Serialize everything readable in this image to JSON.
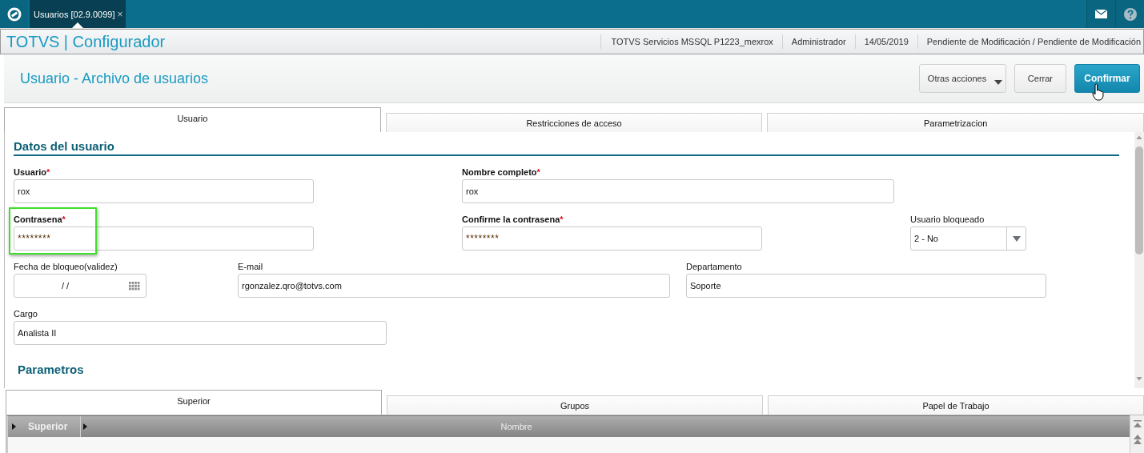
{
  "app_bar": {
    "tabs": [
      {
        "label": "Usuarios [02.9.0099]",
        "close": "×",
        "selected": true
      }
    ]
  },
  "header": {
    "brand": "TOTVS | Configurador",
    "info": [
      "TOTVS Servicios MSSQL P1223_mexrox",
      "Administrador",
      "14/05/2019",
      "Pendiente de Modificación / Pendiente de Modificación"
    ]
  },
  "page": {
    "title": "Usuario - Archivo de usuarios",
    "actions": [
      {
        "label": "Otras acciones",
        "kind": "menu"
      },
      {
        "label": "Cerrar",
        "kind": "secondary"
      },
      {
        "label": "Confirmar",
        "kind": "primary"
      }
    ]
  },
  "tabs": [
    {
      "label": "Usuario",
      "selected": true
    },
    {
      "label": "Restricciones de acceso",
      "selected": false
    },
    {
      "label": "Parametrizacion",
      "selected": false
    }
  ],
  "section": {
    "title": "Datos del usuario",
    "rows": [
      [
        {
          "label": "Usuario",
          "required": true,
          "mark": "*",
          "kind": "text",
          "value": "rox"
        },
        {
          "label": "Nombre completo",
          "required": true,
          "mark": "*",
          "kind": "text",
          "value": "rox"
        }
      ],
      [
        {
          "label": "Contrasena",
          "required": true,
          "mark": "*",
          "kind": "password",
          "value": "********",
          "highlighted": true
        },
        {
          "label": "Confirme la contrasena",
          "required": true,
          "mark": "*",
          "kind": "password",
          "value": "********"
        },
        {
          "label": "Usuario bloqueado",
          "required": false,
          "kind": "select",
          "value": "2 - No"
        }
      ],
      [
        {
          "label": "Fecha de bloqueo(validez)",
          "required": false,
          "kind": "date",
          "value": "/ /"
        },
        {
          "label": "E-mail",
          "required": false,
          "kind": "text",
          "value": "rgonzalez.qro@totvs.com"
        },
        {
          "label": "Departamento",
          "required": false,
          "kind": "text",
          "value": "Soporte"
        }
      ],
      [
        {
          "label": "Cargo",
          "required": false,
          "kind": "text",
          "value": "Analista II"
        }
      ]
    ]
  },
  "next_section": {
    "title": "Parametros"
  },
  "detail_tabs": [
    {
      "label": "Superior",
      "selected": true
    },
    {
      "label": "Grupos",
      "selected": false
    },
    {
      "label": "Papel de Trabajo",
      "selected": false
    }
  ],
  "grid": {
    "columns": [
      {
        "label": "Superior",
        "kind": "key"
      },
      {
        "label": "Nombre",
        "kind": "plain"
      }
    ]
  }
}
